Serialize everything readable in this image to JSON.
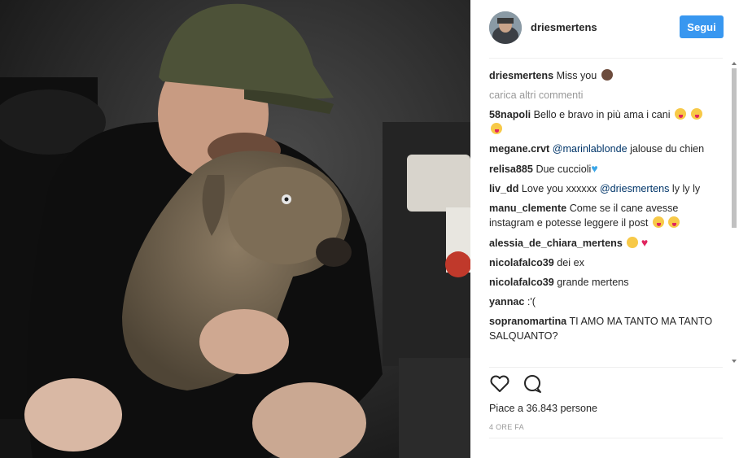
{
  "post": {
    "author": "driesmertens",
    "follow_label": "Segui",
    "caption_user": "driesmertens",
    "caption_text": "Miss you",
    "load_more_label": "carica altri commenti",
    "comments": [
      {
        "user": "58napoli",
        "text": "Bello e bravo in più ama i cani"
      },
      {
        "user": "megane.crvt",
        "mention": "@marinlablonde",
        "text": "jalouse du chien"
      },
      {
        "user": "relisa885",
        "text": "Due cuccioli"
      },
      {
        "user": "liv_dd",
        "text": "Love you xxxxxx",
        "mention": "@driesmertens",
        "text_after": "ly ly ly"
      },
      {
        "user": "manu_clemente",
        "text": "Come se il cane avesse instagram e potesse leggere il post"
      },
      {
        "user": "alessia_de_chiara_mertens",
        "text": ""
      },
      {
        "user": "nicolafalco39",
        "text": "dei ex"
      },
      {
        "user": "nicolafalco39",
        "text": "grande mertens"
      },
      {
        "user": "yannac",
        "text": ":'("
      },
      {
        "user": "sopranomartina",
        "text": "TI AMO MA TANTO MA TANTO SALQUANTO?"
      }
    ],
    "likes_text": "Piace a 36.843 persone",
    "time_text": "4 ORE FA"
  },
  "icons": {
    "like": "heart-outline-icon",
    "comment": "speech-bubble-icon"
  },
  "colors": {
    "follow_button": "#3897f0",
    "mention": "#003569",
    "muted": "#999999"
  }
}
